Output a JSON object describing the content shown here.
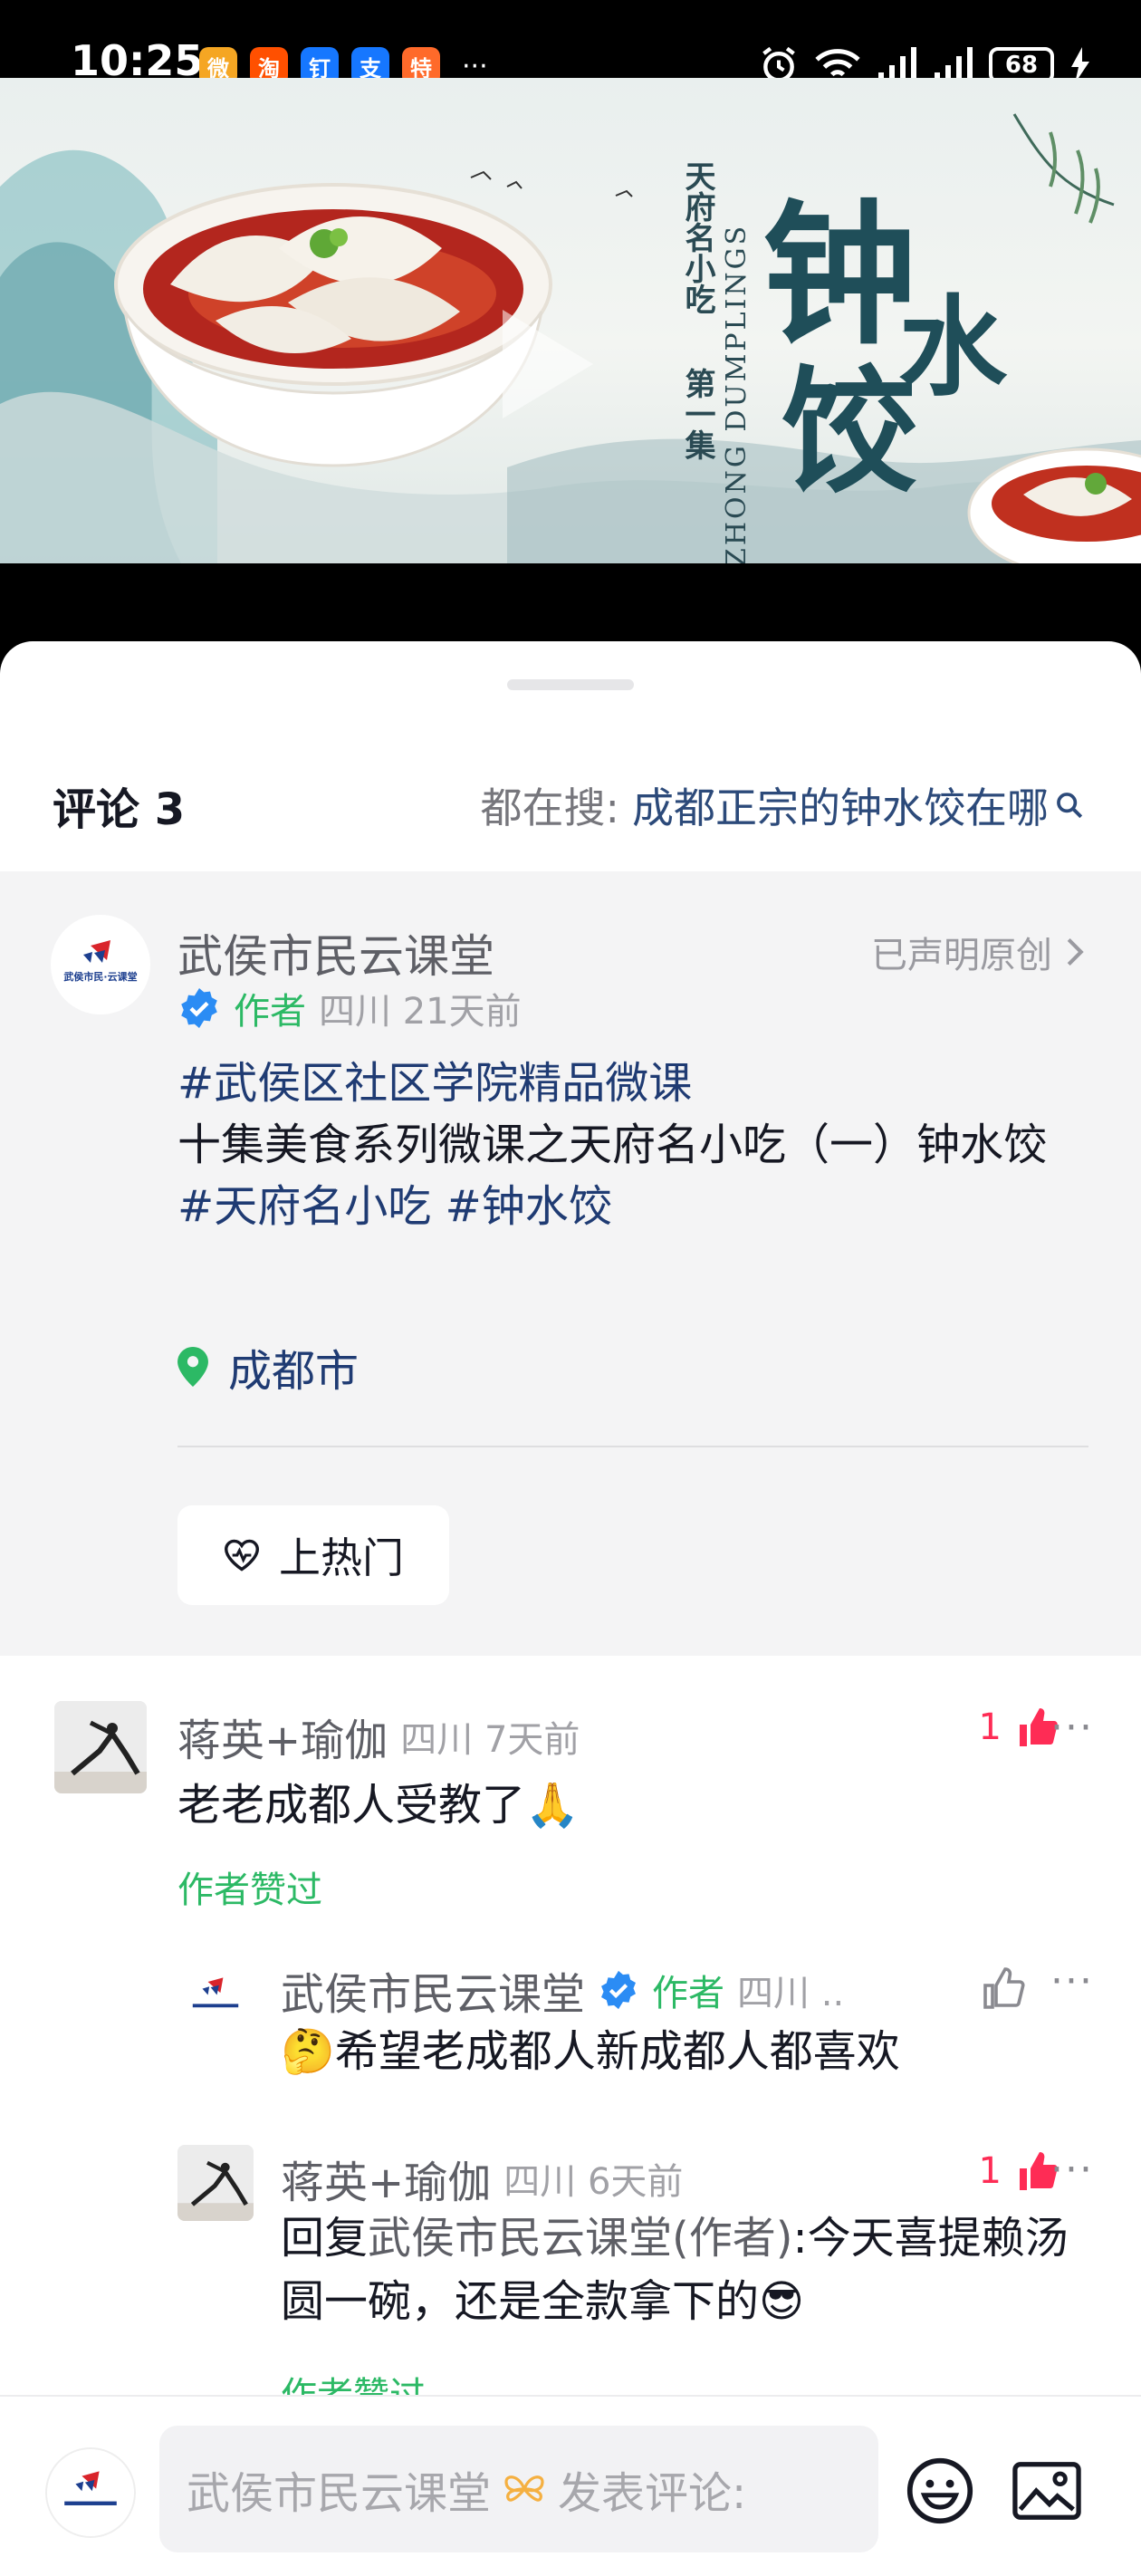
{
  "status_bar": {
    "time": "10:25",
    "apps": [
      {
        "icon": "weibo-icon",
        "glyph": "微",
        "color": "#f5a623"
      },
      {
        "icon": "taobao-icon",
        "glyph": "淘",
        "color": "#ff5000"
      },
      {
        "icon": "dingtalk-icon",
        "glyph": "钉",
        "color": "#1677ff"
      },
      {
        "icon": "alipay-icon",
        "glyph": "支",
        "color": "#1677ff"
      },
      {
        "icon": "taobao-special-icon",
        "glyph": "特",
        "color": "#ff6a2a"
      }
    ],
    "more": "···",
    "battery": "68"
  },
  "video": {
    "series": "天府名小吃",
    "episode": "第一集",
    "title_chars": [
      "钟",
      "水",
      "饺"
    ],
    "english": "ZHONG DUMPLINGS"
  },
  "sheet": {
    "comment_count": "评论 3",
    "search_label": "都在搜:",
    "search_keyword": "成都正宗的钟水饺在哪"
  },
  "post": {
    "author": "武侯市民云课堂",
    "original_label": "已声明原创",
    "author_tag": "作者",
    "region_time": "四川 21天前",
    "tag1": "#武侯区社区学院精品微课",
    "desc": "十集美食系列微课之天府名小吃（一）钟水饺",
    "tags2": "#天府名小吃 #钟水饺",
    "location": "成都市",
    "hot_button": "上热门"
  },
  "comments": [
    {
      "name": "蒋英+瑜伽",
      "meta": "四川 7天前",
      "text": "老老成都人受教了",
      "emoji": "🙏",
      "liked_by_author": "作者赞过",
      "likes": "1"
    },
    {
      "name": "武侯市民云课堂",
      "author_tag": "作者",
      "meta": "四川 ..",
      "emoji": "🤔",
      "text": "希望老成都人新成都人都喜欢"
    },
    {
      "name": "蒋英+瑜伽",
      "meta": "四川 6天前",
      "reply_prefix": "回复",
      "reply_target": "武侯市民云课堂(作者)",
      "text": ":今天喜提赖汤圆一碗，还是全款拿下的",
      "emoji": "😎",
      "liked_by_author": "作者赞过",
      "likes": "1"
    }
  ],
  "input_bar": {
    "placeholder_name": "武侯市民云课堂",
    "placeholder_text": "发表评论:"
  },
  "logo": {
    "org_name": "武侯市民·云课堂"
  }
}
